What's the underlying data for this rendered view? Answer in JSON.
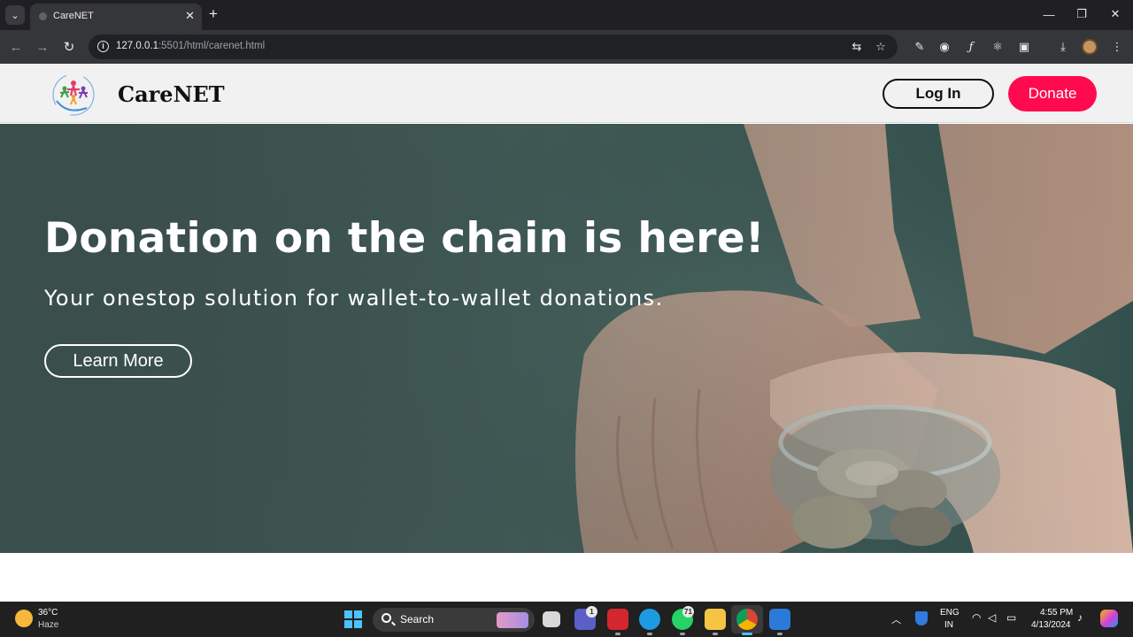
{
  "browser": {
    "tab_title": "CareNET",
    "tab_close": "✕",
    "new_tab": "+",
    "url_host": "127.0.0.1",
    "url_rest": ":5501/html/carenet.html",
    "window_controls": {
      "minimize": "—",
      "maximize": "❐",
      "close": "✕"
    },
    "icons": [
      "back-arrow-icon",
      "forward-arrow-icon",
      "reload-icon",
      "site-info-icon",
      "translate-icon",
      "bookmark-star-icon",
      "extension-icon",
      "camera-icon",
      "fx-icon",
      "react-icon",
      "puzzle-icon",
      "download-icon",
      "profile-avatar",
      "kebab-menu-icon"
    ]
  },
  "site": {
    "brand": "CareNET",
    "login_label": "Log In",
    "donate_label": "Donate",
    "colors": {
      "donate": "#ff0a4f",
      "header_bg": "#f1f1f1",
      "hero_bg": "#3f5a56"
    }
  },
  "hero": {
    "title": "Donation on the chain is here!",
    "subtitle": "Your onestop solution for wallet-to-wallet donations.",
    "cta_label": "Learn More"
  },
  "taskbar": {
    "weather_temp": "36°C",
    "weather_desc": "Haze",
    "search_label": "Search",
    "apps": [
      "start-icon",
      "search-icon",
      "task-view-icon",
      "teams-icon",
      "acrobat-icon",
      "edge-icon",
      "whatsapp-icon",
      "file-explorer-icon",
      "chrome-icon",
      "vscode-icon"
    ],
    "teams_badge": "1",
    "whatsapp_badge": "71",
    "lang_line1": "ENG",
    "lang_line2": "IN",
    "time": "4:55 PM",
    "date": "4/13/2024"
  }
}
